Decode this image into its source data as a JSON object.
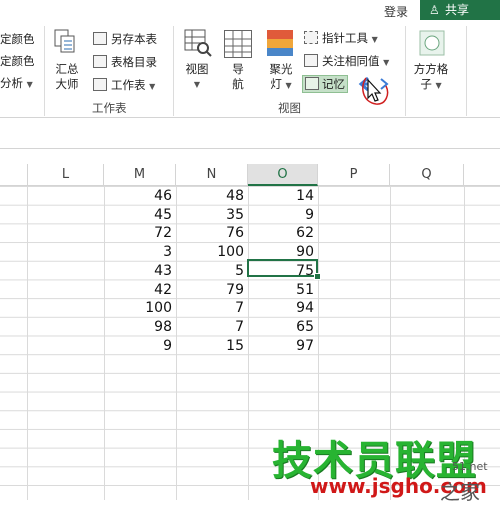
{
  "titlebar": {
    "login": "登录",
    "share": "共享"
  },
  "ribbon": {
    "left_items": [
      "定颜色",
      "定颜色",
      "分析"
    ],
    "summary": {
      "line1": "汇总",
      "line2": "大师"
    },
    "worksheet_items": [
      "另存本表",
      "表格目录",
      "工作表"
    ],
    "worksheet_group": "工作表",
    "view_label": "视图",
    "nav": {
      "line1": "导",
      "line2": "航"
    },
    "spotlight": {
      "line1": "聚光",
      "line2": "灯"
    },
    "pointer_tool": "指针工具",
    "focus_same": "关注相同值",
    "memory": "记忆",
    "view_group": "视图",
    "grid_plus": {
      "line1": "方方格",
      "line2": "子"
    }
  },
  "sheet": {
    "columns": [
      "L",
      "M",
      "N",
      "O",
      "P",
      "Q"
    ],
    "selected_column": "O",
    "rows": [
      {
        "M": "46",
        "N": "48",
        "O": "14"
      },
      {
        "M": "45",
        "N": "35",
        "O": "9"
      },
      {
        "M": "72",
        "N": "76",
        "O": "62"
      },
      {
        "M": "3",
        "N": "100",
        "O": "90"
      },
      {
        "M": "43",
        "N": "5",
        "O": "75"
      },
      {
        "M": "42",
        "N": "79",
        "O": "51"
      },
      {
        "M": "100",
        "N": "7",
        "O": "94"
      },
      {
        "M": "98",
        "N": "7",
        "O": "65"
      },
      {
        "M": "9",
        "N": "15",
        "O": "97"
      }
    ]
  },
  "watermark": {
    "brand": "技术员联盟",
    "url": "www.jsgho.com",
    "site_small": "51.net",
    "home": "之家"
  },
  "colors": {
    "accent": "#217346",
    "memory_bg": "#c5e0c8",
    "watermark_green": "#28b432",
    "watermark_red": "#d01818"
  }
}
